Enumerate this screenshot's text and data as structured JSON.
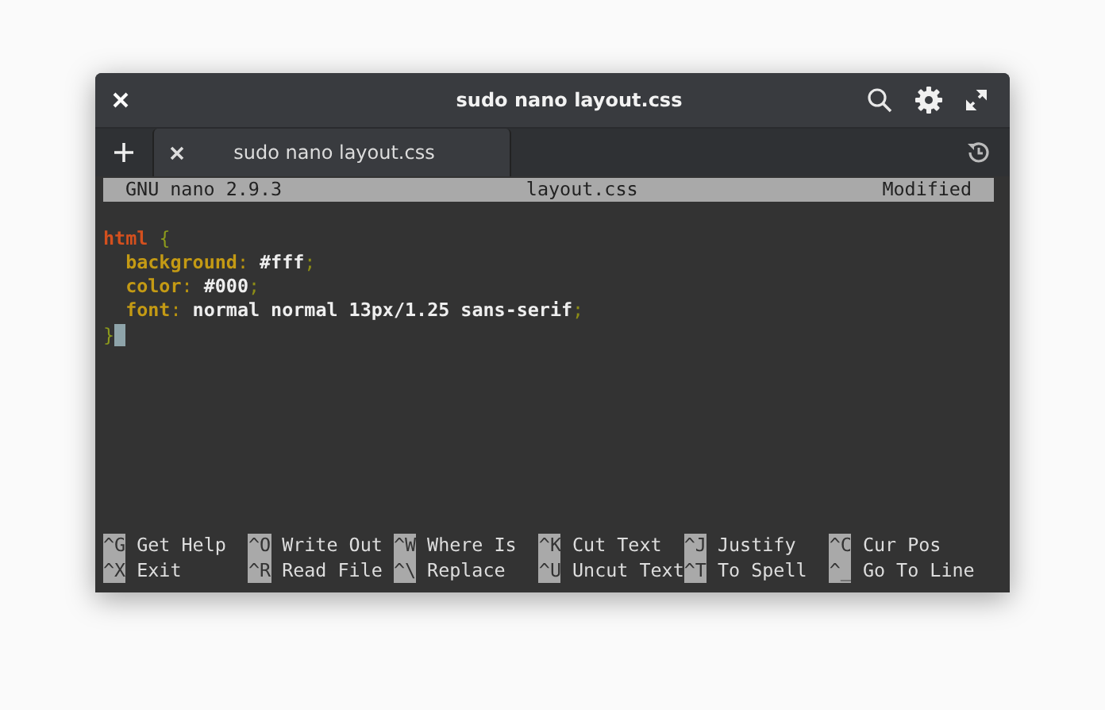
{
  "window": {
    "title": "sudo nano layout.css"
  },
  "tabs": [
    {
      "label": "sudo nano layout.css",
      "selected": true
    }
  ],
  "status_bar": {
    "program": "GNU nano 2.9.3",
    "file": "layout.css",
    "state": "Modified"
  },
  "code_lines": [
    {
      "indented": false,
      "cursor": false,
      "tokens": [
        {
          "kind": "selector",
          "text": "html"
        },
        {
          "kind": "brace",
          "text": "{"
        }
      ]
    },
    {
      "indented": true,
      "cursor": false,
      "tokens": [
        {
          "kind": "property",
          "text": "background"
        },
        {
          "kind": "colon",
          "text": ":"
        },
        {
          "kind": "value",
          "text": "#fff"
        },
        {
          "kind": "semicolon",
          "text": ";"
        }
      ]
    },
    {
      "indented": true,
      "cursor": false,
      "tokens": [
        {
          "kind": "property",
          "text": "color"
        },
        {
          "kind": "colon",
          "text": ":"
        },
        {
          "kind": "value",
          "text": "#000"
        },
        {
          "kind": "semicolon",
          "text": ";"
        }
      ]
    },
    {
      "indented": true,
      "cursor": false,
      "tokens": [
        {
          "kind": "property",
          "text": "font"
        },
        {
          "kind": "colon",
          "text": ":"
        },
        {
          "kind": "value",
          "text": "normal normal 13px/1.25 sans-serif"
        },
        {
          "kind": "semicolon",
          "text": ";"
        }
      ]
    },
    {
      "indented": false,
      "cursor": true,
      "tokens": [
        {
          "kind": "brace",
          "text": "}"
        }
      ]
    }
  ],
  "shortcuts": [
    {
      "key": "^G",
      "label": "Get Help"
    },
    {
      "key": "^O",
      "label": "Write Out"
    },
    {
      "key": "^W",
      "label": "Where Is"
    },
    {
      "key": "^K",
      "label": "Cut Text"
    },
    {
      "key": "^J",
      "label": "Justify"
    },
    {
      "key": "^C",
      "label": "Cur Pos"
    },
    {
      "key": "^X",
      "label": "Exit"
    },
    {
      "key": "^R",
      "label": "Read File"
    },
    {
      "key": "^\\",
      "label": "Replace"
    },
    {
      "key": "^U",
      "label": "Uncut Text"
    },
    {
      "key": "^T",
      "label": "To Spell"
    },
    {
      "key": "^_",
      "label": "Go To Line"
    }
  ]
}
